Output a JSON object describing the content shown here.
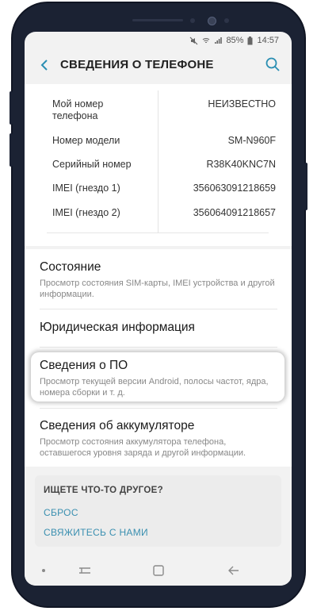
{
  "status_bar": {
    "battery": "85%",
    "time": "14:57",
    "icons": [
      "mute-icon",
      "wifi-icon",
      "signal-icon",
      "battery-icon"
    ]
  },
  "header": {
    "title": "СВЕДЕНИЯ О ТЕЛЕФОНЕ",
    "back_icon": "back-arrow-icon",
    "search_icon": "search-icon"
  },
  "info": {
    "rows": [
      {
        "label": "Мой номер телефона",
        "value": "НЕИЗВЕСТНО"
      },
      {
        "label": "Номер модели",
        "value": "SM-N960F"
      },
      {
        "label": "Серийный номер",
        "value": "R38K40KNC7N"
      },
      {
        "label": "IMEI (гнездо 1)",
        "value": "356063091218659"
      },
      {
        "label": "IMEI (гнездо 2)",
        "value": "356064091218657"
      }
    ]
  },
  "menu": {
    "items": [
      {
        "title": "Состояние",
        "desc": "Просмотр состояния SIM-карты, IMEI устройства и другой информации."
      },
      {
        "title": "Юридическая информация",
        "desc": ""
      },
      {
        "title": "Сведения о ПО",
        "desc": "Просмотр текущей версии Android, полосы частот, ядра, номера сборки и т. д."
      },
      {
        "title": "Сведения об аккумуляторе",
        "desc": "Просмотр состояния аккумулятора телефона, оставшегося уровня заряда и другой информации."
      }
    ]
  },
  "other": {
    "title": "ИЩЕТЕ ЧТО-ТО ДРУГОЕ?",
    "links": [
      "СБРОС",
      "СВЯЖИТЕСЬ С НАМИ"
    ]
  },
  "navbar": {
    "icons": [
      "dot-icon",
      "recents-icon",
      "home-icon",
      "back-icon"
    ]
  },
  "colors": {
    "accent": "#3a8fb0",
    "frame": "#1b2233",
    "background": "#f2f2f2"
  }
}
